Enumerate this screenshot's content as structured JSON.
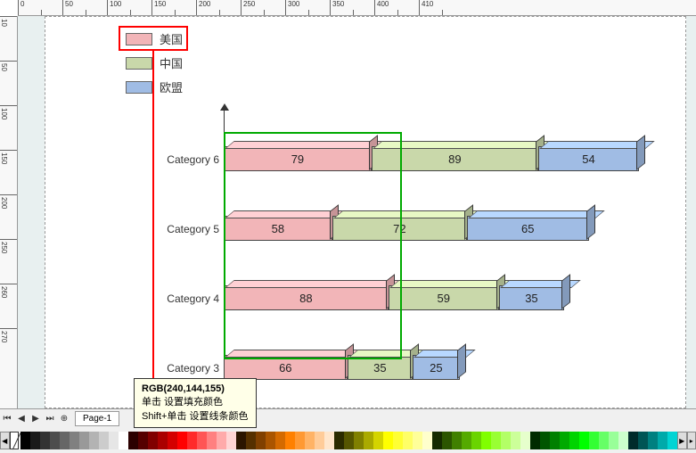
{
  "ruler_h": [
    0,
    50,
    100,
    150,
    200,
    250,
    300,
    350,
    400,
    410
  ],
  "ruler_v": [
    10,
    50,
    100,
    150,
    200,
    250,
    260,
    270
  ],
  "legend": [
    {
      "label": "美国",
      "color": "#f2b5b8"
    },
    {
      "label": "中国",
      "color": "#c9d8aa"
    },
    {
      "label": "欧盟",
      "color": "#a0bce4"
    }
  ],
  "chart_data": {
    "type": "bar",
    "orientation": "horizontal",
    "stacked": true,
    "categories": [
      "Category 6",
      "Category 5",
      "Category 4",
      "Category 3"
    ],
    "series": [
      {
        "name": "美国",
        "color": "#f2b5b8",
        "values": [
          79,
          58,
          88,
          66
        ]
      },
      {
        "name": "中国",
        "color": "#c9d8aa",
        "values": [
          89,
          72,
          59,
          35
        ]
      },
      {
        "name": "欧盟",
        "color": "#a0bce4",
        "values": [
          54,
          65,
          35,
          25
        ]
      }
    ]
  },
  "nav": {
    "page_label": "Page-1"
  },
  "tooltip": {
    "title": "RGB(240,144,155)",
    "line1": "单击 设置填充颜色",
    "line2": "Shift+单击 设置线条颜色"
  },
  "palette": [
    "#000000",
    "#1a1a1a",
    "#333333",
    "#4d4d4d",
    "#666666",
    "#808080",
    "#999999",
    "#b3b3b3",
    "#cccccc",
    "#e6e6e6",
    "#ffffff",
    "#2b0000",
    "#550000",
    "#800000",
    "#aa0000",
    "#d40000",
    "#ff0000",
    "#ff2a2a",
    "#ff5555",
    "#ff8080",
    "#ffaaaa",
    "#ffd5d5",
    "#2b1500",
    "#553000",
    "#804000",
    "#aa5500",
    "#d46a00",
    "#ff8000",
    "#ff9933",
    "#ffb366",
    "#ffcc99",
    "#ffe6cc",
    "#2b2b00",
    "#555500",
    "#808000",
    "#aaaa00",
    "#d4d400",
    "#ffff00",
    "#ffff33",
    "#ffff66",
    "#ffff99",
    "#ffffcc",
    "#152b00",
    "#2b5500",
    "#408000",
    "#55aa00",
    "#6ad400",
    "#80ff00",
    "#99ff33",
    "#b3ff66",
    "#ccff99",
    "#e6ffcc",
    "#002b00",
    "#005500",
    "#008000",
    "#00aa00",
    "#00d400",
    "#00ff00",
    "#33ff33",
    "#66ff66",
    "#99ff99",
    "#ccffcc",
    "#002b2b",
    "#005555",
    "#008080",
    "#00aaaa",
    "#00d4d4"
  ]
}
